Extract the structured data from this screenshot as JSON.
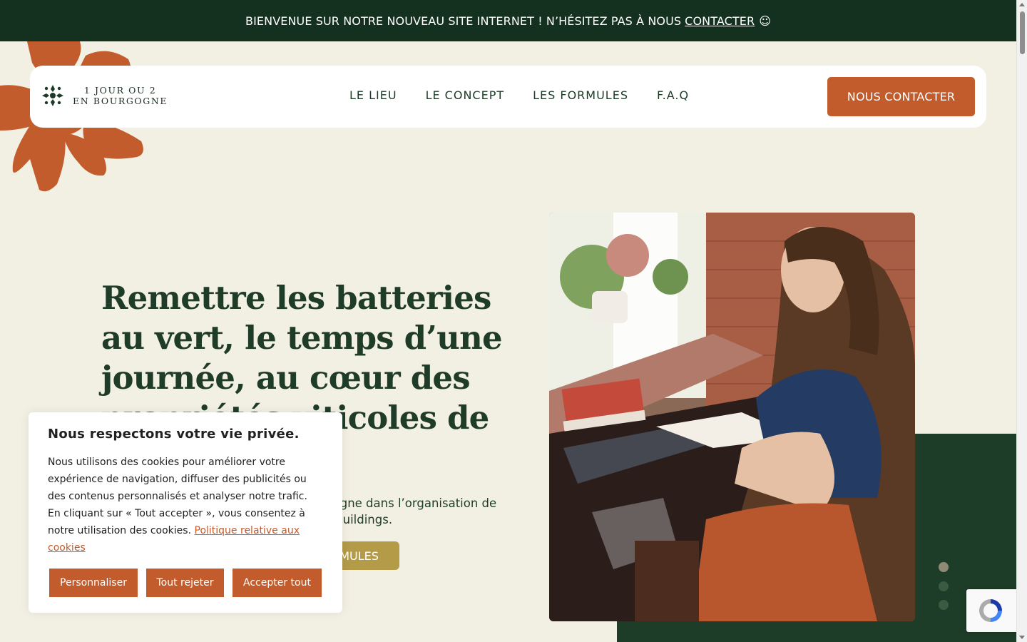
{
  "announcement": {
    "text": "BIENVENUE SUR NOTRE NOUVEAU SITE INTERNET ! N’HÉSITEZ PAS À NOUS",
    "link_label": "CONTACTER",
    "emoji": "☺"
  },
  "brand": {
    "line1": "1 JOUR OU 2",
    "line2": "EN BOURGOGNE"
  },
  "nav": {
    "items": [
      {
        "label": "LE LIEU"
      },
      {
        "label": "LE CONCEPT"
      },
      {
        "label": "LES FORMULES"
      },
      {
        "label": "F.A.Q"
      }
    ],
    "cta_label": "NOUS CONTACTER"
  },
  "hero": {
    "title": "Remettre les batteries au vert, le temps d’une journée, au cœur des propriétés viticoles de Bourgogne",
    "text": "1 jour ou 2 en Bourgogne vous accompagne dans l’organisation de journée séminaires, séjours et de team buildings.",
    "button_label": "LES FORMULES",
    "slider_dots": 3,
    "slider_active": 1
  },
  "cookie": {
    "title": "Nous respectons votre vie privée.",
    "text": "Nous utilisons des cookies pour améliorer votre expérience de navigation, diffuser des publicités ou des contenus personnalisés et analyser notre trafic. En cliquant sur « Tout accepter », vous consentez à notre utilisation des cookies.",
    "policy_link": "Politique relative aux cookies",
    "customize_label": "Personnaliser",
    "reject_label": "Tout rejeter",
    "accept_label": "Accepter tout"
  },
  "colors": {
    "banner": "#14311f",
    "accent": "#c35c2c",
    "gold": "#b39b48",
    "dark_green": "#1e3d29",
    "background": "#f2efe3"
  },
  "icons": {
    "logo": "flower-cross-icon",
    "recaptcha": "recaptcha-icon"
  }
}
